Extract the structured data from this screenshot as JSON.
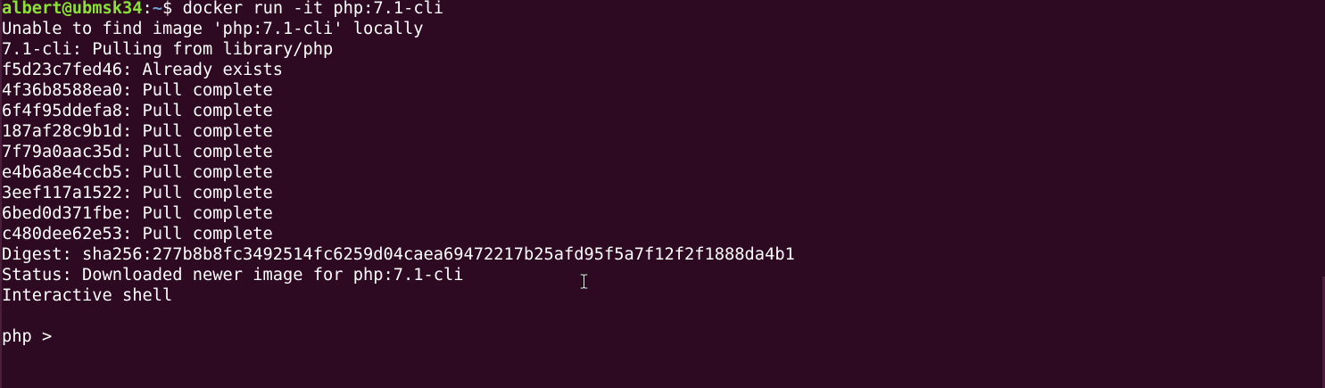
{
  "terminal": {
    "prompt": {
      "user_host": "albert@ubmsk34",
      "separator": ":",
      "path": "~",
      "symbol": "$ ",
      "command": "docker run -it php:7.1-cli"
    },
    "output_lines": [
      "Unable to find image 'php:7.1-cli' locally",
      "7.1-cli: Pulling from library/php",
      "f5d23c7fed46: Already exists",
      "4f36b8588ea0: Pull complete",
      "6f4f95ddefa8: Pull complete",
      "187af28c9b1d: Pull complete",
      "7f79a0aac35d: Pull complete",
      "e4b6a8e4ccb5: Pull complete",
      "3eef117a1522: Pull complete",
      "6bed0d371fbe: Pull complete",
      "c480dee62e53: Pull complete",
      "Digest: sha256:277b8b8fc3492514fc6259d04caea69472217b25afd95f5a7f12f2f1888da4b1",
      "Status: Downloaded newer image for php:7.1-cli",
      "Interactive shell"
    ],
    "php_prompt": "php > ",
    "colors": {
      "background": "#2e0a22",
      "text": "#ffffff",
      "user_host": "#8ae234",
      "path": "#729fcf"
    },
    "cursor_icon": "text-ibeam-icon"
  }
}
